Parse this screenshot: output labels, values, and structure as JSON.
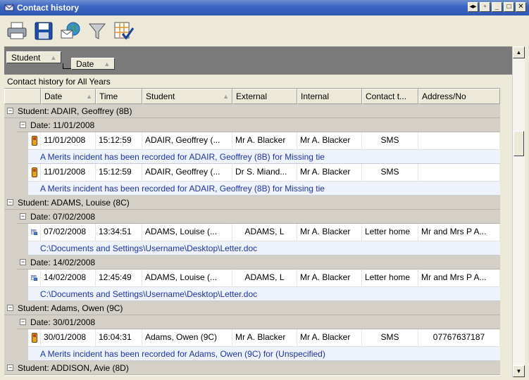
{
  "window": {
    "title": "Contact history"
  },
  "group_panel": {
    "chips": [
      "Student",
      "Date"
    ]
  },
  "caption": "Contact history for All Years",
  "columns": [
    "Date",
    "Time",
    "Student",
    "External",
    "Internal",
    "Contact t...",
    "Address/No"
  ],
  "groups": [
    {
      "student_label": "Student:  ADAIR, Geoffrey (8B)",
      "dates": [
        {
          "date_label": "Date:  11/01/2008",
          "rows": [
            {
              "icon": "phone-icon",
              "date": "11/01/2008",
              "time": "15:12:59",
              "student": "ADAIR,  Geoffrey (...",
              "external": "Mr A. Blacker",
              "internal": "Mr A. Blacker",
              "contact": "SMS",
              "address": "",
              "preview": "A Merits incident has been recorded for ADAIR, Geoffrey (8B) for Missing tie"
            },
            {
              "icon": "phone-icon",
              "date": "11/01/2008",
              "time": "15:12:59",
              "student": "ADAIR,  Geoffrey (...",
              "external": "Dr S. Miand...",
              "internal": "Mr A. Blacker",
              "contact": "SMS",
              "address": "",
              "preview": "A Merits incident has been recorded for ADAIR, Geoffrey (8B) for Missing tie"
            }
          ]
        }
      ]
    },
    {
      "student_label": "Student:  ADAMS, Louise (8C)",
      "dates": [
        {
          "date_label": "Date:  07/02/2008",
          "rows": [
            {
              "icon": "letter-icon",
              "date": "07/02/2008",
              "time": "13:34:51",
              "student": "ADAMS,  Louise (...",
              "external": "ADAMS, L",
              "internal": "Mr A. Blacker",
              "contact": "Letter home",
              "address": "Mr and Mrs P A...",
              "preview": "C:\\Documents and Settings\\Username\\Desktop\\Letter.doc"
            }
          ]
        },
        {
          "date_label": "Date:  14/02/2008",
          "rows": [
            {
              "icon": "letter-icon",
              "date": "14/02/2008",
              "time": "12:45:49",
              "student": "ADAMS,  Louise (...",
              "external": "ADAMS, L",
              "internal": "Mr A. Blacker",
              "contact": "Letter home",
              "address": "Mr and Mrs P A...",
              "preview": "C:\\Documents and Settings\\Username\\Desktop\\Letter.doc"
            }
          ]
        }
      ]
    },
    {
      "student_label": "Student:  Adams, Owen (9C)",
      "dates": [
        {
          "date_label": "Date:  30/01/2008",
          "rows": [
            {
              "icon": "phone-icon",
              "date": "30/01/2008",
              "time": "16:04:31",
              "student": "Adams, Owen (9C)",
              "external": "Mr A. Blacker",
              "internal": "Mr A. Blacker",
              "contact": "SMS",
              "address": "07767637187",
              "preview": "A Merits incident has been recorded for Adams, Owen (9C) for (Unspecified)"
            }
          ]
        }
      ]
    },
    {
      "student_label": "Student:  ADDISON, Avie (8D)",
      "dates": []
    }
  ]
}
